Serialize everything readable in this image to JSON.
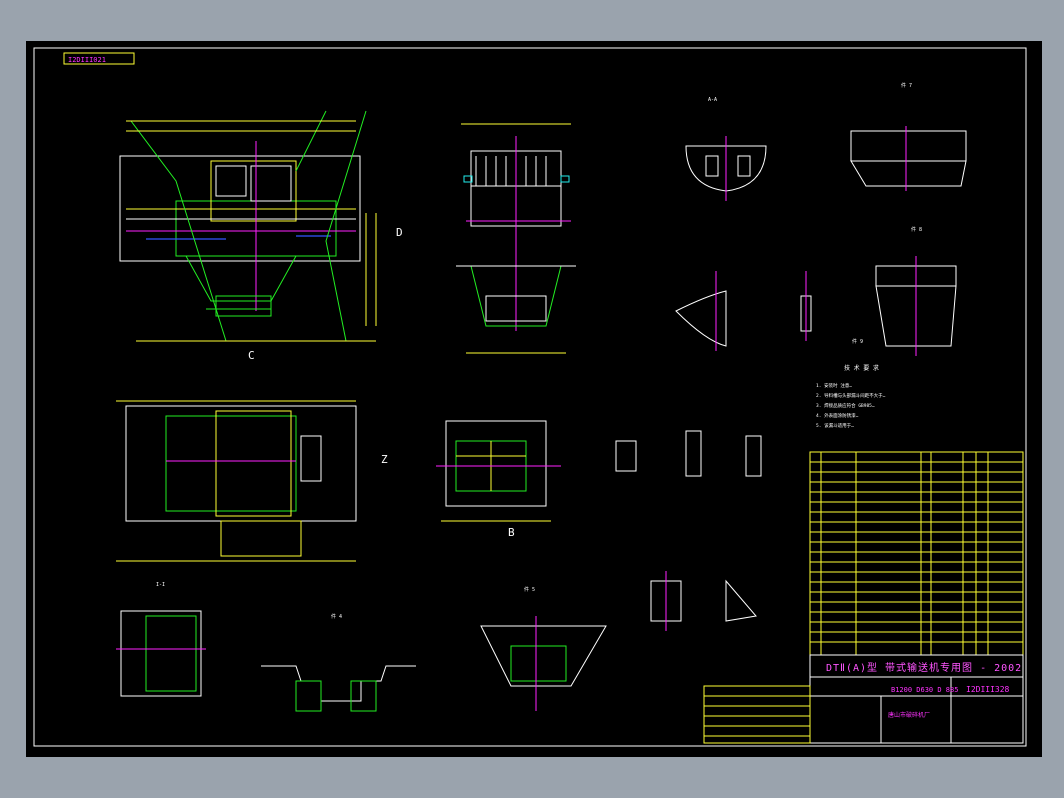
{
  "drawing": {
    "drawing_number_tag": "I2DIII021",
    "title_block": {
      "main_title": "DTⅡ(A)型 带式输送机专用图 - 2002",
      "sub_code": "B1200 D630 D 885",
      "drawing_code": "I2DIII328",
      "company": "唐山市破碎机厂"
    },
    "view_labels": {
      "top_right_1": "A-A",
      "top_right_2": "件 7",
      "top_right_3": "件 8",
      "mid_1": "件 9",
      "bottom_1": "I-I",
      "bottom_2": "件 4",
      "bottom_3": "件 5"
    },
    "section_marks": {
      "d": "D",
      "z": "Z",
      "c": "C",
      "b": "B"
    },
    "tech_requirements": {
      "heading": "技 术 要 求",
      "lines": [
        "1. 安装时 注意…",
        "2. 导料槽与头部漏斗间距不大于…",
        "3. 焊接品质应符合 GB985…",
        "4. 外表面涂防锈漆…",
        "5. 该漏斗适用于…"
      ]
    }
  }
}
